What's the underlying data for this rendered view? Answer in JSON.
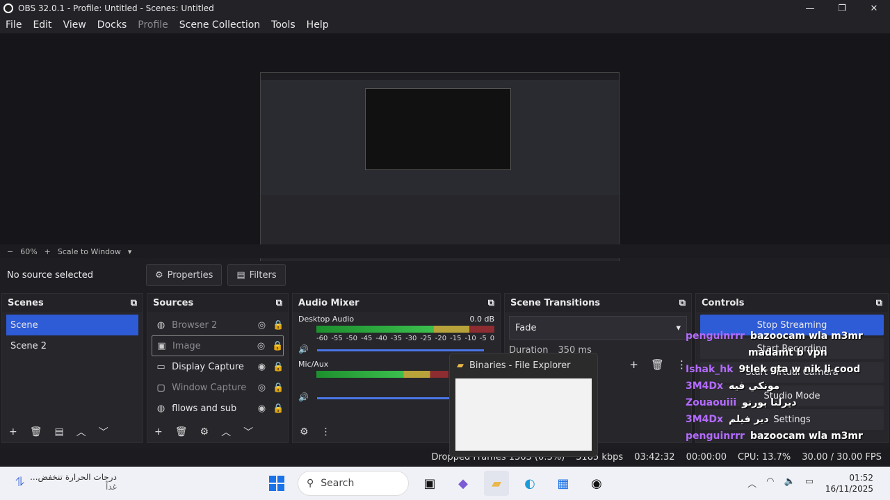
{
  "window": {
    "title": "OBS 32.0.1 - Profile: Untitled - Scenes: Untitled",
    "controls": [
      "—",
      "❐",
      "✕"
    ]
  },
  "menu": [
    "File",
    "Edit",
    "View",
    "Docks",
    "Profile",
    "Scene Collection",
    "Tools",
    "Help"
  ],
  "zoom": {
    "minus": "−",
    "value": "60%",
    "plus": "+",
    "mode": "Scale to Window"
  },
  "source_bar": {
    "status": "No source selected",
    "properties": "Properties",
    "filters": "Filters"
  },
  "scenes": {
    "title": "Scenes",
    "items": [
      "Scene",
      "Scene 2"
    ],
    "active": 0
  },
  "sources": {
    "title": "Sources",
    "items": [
      {
        "name": "Browser 2",
        "icon": "globe-icon",
        "visible": false
      },
      {
        "name": "Image",
        "icon": "image-icon",
        "visible": false
      },
      {
        "name": "Display Capture",
        "icon": "monitor-icon",
        "visible": true
      },
      {
        "name": "Window Capture",
        "icon": "window-icon",
        "visible": false
      },
      {
        "name": "fllows and sub",
        "icon": "globe-icon",
        "visible": true
      }
    ]
  },
  "audio": {
    "title": "Audio Mixer",
    "channels": [
      {
        "name": "Desktop Audio",
        "level": "0.0 dB"
      },
      {
        "name": "Mic/Aux",
        "level": ""
      }
    ],
    "ticks": [
      "-60",
      "-55",
      "-50",
      "-45",
      "-40",
      "-35",
      "-30",
      "-25",
      "-20",
      "-15",
      "-10",
      "-5",
      "0"
    ]
  },
  "transitions": {
    "title": "Scene Transitions",
    "selected": "Fade",
    "duration_label": "Duration",
    "duration": "350 ms"
  },
  "controls": {
    "title": "Controls",
    "buttons": [
      "Stop Streaming",
      "Start Recording",
      "Start Virtual Camera",
      "Studio Mode",
      "Settings"
    ]
  },
  "chat": [
    {
      "user": "penguinrrr",
      "msg": "bazoocam wla m3mr"
    },
    {
      "user": "",
      "msg": "madamt b vpn"
    },
    {
      "user": "Ishak_hk",
      "msg": "9tlek gta w nik li cood"
    },
    {
      "user": "3M4Dx",
      "msg": "مونكي فيه"
    },
    {
      "user": "Zouaouiii",
      "msg": "ديرلنا بورنو"
    },
    {
      "user": "3M4Dx",
      "msg": "دير فيلم"
    },
    {
      "user": "penguinrrr",
      "msg": "bazoocam wla m3mr"
    },
    {
      "user": "",
      "msg": "madamt b vpn"
    }
  ],
  "flyout": {
    "title": "Binaries - File Explorer"
  },
  "status": {
    "dropped": "Dropped Frames 1363 (0.3%)",
    "kbps": "3185 kbps",
    "live": "03:42:32",
    "rec": "00:00:00",
    "cpu": "CPU: 13.7%",
    "fps": "30.00 / 30.00 FPS"
  },
  "taskbar": {
    "weather": "درجات الحرارة تنخفض...",
    "weather_sub": "غداً",
    "search": "Search",
    "time": "01:52",
    "date": "16/11/2025"
  }
}
